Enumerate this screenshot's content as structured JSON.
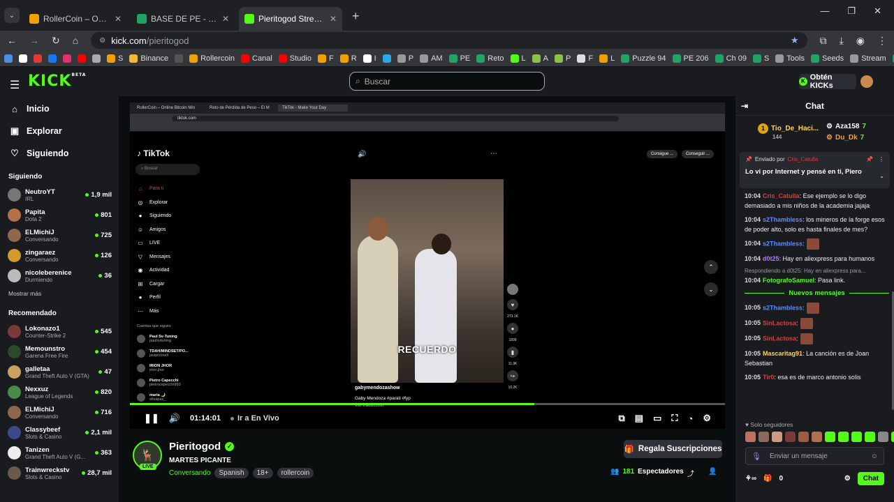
{
  "browser": {
    "tabs": [
      {
        "title": "RollerCoin – Online Bitcoin Mi",
        "color": "#f2a100",
        "active": false
      },
      {
        "title": "BASE DE PE - Hojas de cálculo",
        "color": "#1fa463",
        "active": false
      },
      {
        "title": "Pieritogod Stream - Watch",
        "color": "#53fc18",
        "active": true
      }
    ],
    "url_host": "kick.com",
    "url_path": "/pieritogod",
    "bookmarks": [
      {
        "label": "",
        "color": "#4a90e2"
      },
      {
        "label": "",
        "color": "#fff"
      },
      {
        "label": "",
        "color": "#e53935"
      },
      {
        "label": "",
        "color": "#1877f2"
      },
      {
        "label": "",
        "color": "#e1306c"
      },
      {
        "label": "",
        "color": "#ff0000"
      },
      {
        "label": "",
        "color": "#aaa"
      },
      {
        "label": "S",
        "color": "#f2a100"
      },
      {
        "label": "Binance",
        "color": "#f3ba2f"
      },
      {
        "label": "",
        "color": "#555"
      },
      {
        "label": "Rollercoin",
        "color": "#f2a100"
      },
      {
        "label": "Canal",
        "color": "#ff0000"
      },
      {
        "label": "Studio",
        "color": "#ff0000"
      },
      {
        "label": "F",
        "color": "#f2a100"
      },
      {
        "label": "R",
        "color": "#f2a100"
      },
      {
        "label": "I",
        "color": "#fff"
      },
      {
        "label": "",
        "color": "#29a9eb"
      },
      {
        "label": "P",
        "color": "#999"
      },
      {
        "label": "AM",
        "color": "#999"
      },
      {
        "label": "PE",
        "color": "#1fa463"
      },
      {
        "label": "Reto",
        "color": "#1fa463"
      },
      {
        "label": "L",
        "color": "#53fc18"
      },
      {
        "label": "A",
        "color": "#8bc34a"
      },
      {
        "label": "P",
        "color": "#8bc34a"
      },
      {
        "label": "F",
        "color": "#ddd"
      },
      {
        "label": "L",
        "color": "#f2a100"
      },
      {
        "label": "Puzzle 94",
        "color": "#1fa463"
      },
      {
        "label": "PE 206",
        "color": "#1fa463"
      },
      {
        "label": "Ch 09",
        "color": "#1fa463"
      },
      {
        "label": "S",
        "color": "#1fa463"
      },
      {
        "label": "Tools",
        "color": "#999"
      },
      {
        "label": "Seeds",
        "color": "#1fa463"
      },
      {
        "label": "Stream",
        "color": "#999"
      },
      {
        "label": "Sch",
        "color": "#1fa463"
      }
    ]
  },
  "header": {
    "logo": "KICK",
    "logo_beta": "BETA",
    "search_placeholder": "Buscar",
    "get_kicks": "Obtén KICKs"
  },
  "sidebar": {
    "nav": [
      {
        "label": "Inicio",
        "icon": "home-icon",
        "glyph": "⌂"
      },
      {
        "label": "Explorar",
        "icon": "browse-icon",
        "glyph": "▣"
      },
      {
        "label": "Siguiendo",
        "icon": "heart-icon",
        "glyph": "♡"
      }
    ],
    "following_title": "Siguiendo",
    "following": [
      {
        "name": "NeutroYT",
        "category": "IRL",
        "viewers": "1,9 mil",
        "color": "#777"
      },
      {
        "name": "Papita",
        "category": "Dota 2",
        "viewers": "801",
        "color": "#b5704a"
      },
      {
        "name": "ELMichiJ",
        "category": "Conversando",
        "viewers": "725",
        "color": "#8a6a4a"
      },
      {
        "name": "zingaraez",
        "category": "Conversando",
        "viewers": "126",
        "color": "#d29a2a"
      },
      {
        "name": "nicoleberenice",
        "category": "Durmiendo",
        "viewers": "36",
        "color": "#bbb"
      }
    ],
    "show_more": "Mostrar más",
    "recommended_title": "Recomendado",
    "recommended": [
      {
        "name": "Lokonazo1",
        "category": "Counter-Strike 2",
        "viewers": "545",
        "color": "#7a3a3a"
      },
      {
        "name": "Memounstro",
        "category": "Garena Free Fire",
        "viewers": "454",
        "color": "#2a4a2a"
      },
      {
        "name": "galletaa",
        "category": "Grand Theft Auto V (GTA)",
        "viewers": "47",
        "color": "#caa060"
      },
      {
        "name": "Nexxuz",
        "category": "League of Legends",
        "viewers": "820",
        "color": "#4a8a4a"
      },
      {
        "name": "ELMichiJ",
        "category": "Conversando",
        "viewers": "716",
        "color": "#8a6a4a"
      },
      {
        "name": "Classybeef",
        "category": "Slots & Casino",
        "viewers": "2,1 mil",
        "color": "#3a4a8a"
      },
      {
        "name": "Tanizen",
        "category": "Grand Theft Auto V (G...",
        "viewers": "363",
        "color": "#eee"
      },
      {
        "name": "Trainwreckstv",
        "category": "Slots & Casino",
        "viewers": "28,7 mil",
        "color": "#6a5a4a"
      }
    ]
  },
  "player": {
    "inner_tabs": [
      "RollerCoin – Online Bitcoin Min",
      "Reto de Pérdida de Peso – El M",
      "TikTok - Make Your Day"
    ],
    "inner_url": "tiktok.com",
    "tiktok": {
      "logo": "TikTok",
      "search": "Buscar",
      "menu": [
        {
          "label": "Para ti",
          "glyph": "⌂",
          "red": true
        },
        {
          "label": "Explorar",
          "glyph": "◎",
          "red": false
        },
        {
          "label": "Siguiendo",
          "glyph": "●",
          "red": false
        },
        {
          "label": "Amigos",
          "glyph": "☺",
          "red": false
        },
        {
          "label": "LIVE",
          "glyph": "▭",
          "red": false
        },
        {
          "label": "Mensajes",
          "glyph": "▽",
          "red": false
        },
        {
          "label": "Actividad",
          "glyph": "◉",
          "red": false
        },
        {
          "label": "Cargar",
          "glyph": "⊞",
          "red": false
        },
        {
          "label": "Perfil",
          "glyph": "●",
          "red": false
        },
        {
          "label": "Más",
          "glyph": "⋯",
          "red": false
        }
      ],
      "follows_title": "Cuentas que sigues",
      "follows": [
        {
          "name": "Paul Sv-Tuning",
          "handle": "paulsvtuning"
        },
        {
          "name": "TDAH/MINDSET/PO...",
          "handle": "javipiconell"
        },
        {
          "name": "IRION JHOR",
          "handle": "irion.jhor"
        },
        {
          "name": "Pietro Capecchi",
          "handle": "pietrocapecchi993"
        },
        {
          "name": "maria 🌙",
          "handle": "ellsapaz_"
        }
      ],
      "top_right": [
        "Consigue ...",
        "Conseguir ..."
      ],
      "caption_overlay": "RECUERDO",
      "author": "gabymendozashow",
      "description": "Gaby Mendoza #parati #fyp",
      "translate": "Ver traducción",
      "counts": [
        "273.1K",
        "1899",
        "11.9K",
        "10.2K"
      ]
    },
    "progress": 0.68,
    "time": "01:14:01",
    "go_live": "Ir a En Vivo"
  },
  "streamer": {
    "name": "Pieritogod",
    "title": "MARTES PICANTE",
    "category": "Conversando",
    "tags": [
      "Spanish",
      "18+",
      "rollercoin"
    ],
    "live_label": "LIVE",
    "gift_button": "Regala Suscripciones",
    "viewers_count": "181",
    "viewers_label": "Espectadores"
  },
  "chat": {
    "title": "Chat",
    "leaderboard": {
      "first_name": "Tio_De_Haci...",
      "first_rank": "1",
      "first_score": "144",
      "second_name": "Aza158",
      "second_score": "7",
      "third_name": "Du_Dk",
      "third_score": "7"
    },
    "pinned": {
      "sent_by": "Enviado por",
      "user": "Cris_Catulla",
      "message": "Lo vi por Internet y pensé en ti, Piero"
    },
    "messages": [
      {
        "time": "10:04",
        "user": "Cris_Catulla",
        "color": "#e23b3b",
        "text": ": Ese ejemplo se lo digo demasiado a mis niños de la academia jajaja"
      },
      {
        "time": "10:04",
        "user": "s2Thambless",
        "color": "#5b8dff",
        "text": ": los mineros de la forge esos de poder alto, solo es hasta finales de mes?"
      },
      {
        "time": "10:04",
        "user": "s2Thambless",
        "color": "#5b8dff",
        "text": ":"
      },
      {
        "time": "10:04",
        "user": "d0t25",
        "color": "#b67df8",
        "text": ": Hay en aliexpress para humanos"
      },
      {
        "time": "10:04",
        "user": "FotografoSamuel",
        "color": "#53fc18",
        "text": ": Pasa link.",
        "reply": "Respondiendo a d0t25: Hay en aliexpress para..."
      }
    ],
    "new_messages": "Nuevos mensajes",
    "messages2": [
      {
        "time": "10:05",
        "user": "s2Thambless",
        "color": "#5b8dff",
        "text": ":"
      },
      {
        "time": "10:05",
        "user": "SinLactosa",
        "color": "#e23b3b",
        "text": ":"
      },
      {
        "time": "10:05",
        "user": "SinLactosa",
        "color": "#e23b3b",
        "text": ":"
      },
      {
        "time": "10:05",
        "user": "Mascaritag91",
        "color": "#ffd54f",
        "text": ": La canción es de Joan Sebastian"
      },
      {
        "time": "10:05",
        "user": "Tir0",
        "color": "#e23b3b",
        "text": ": esa es de marco antonio solis"
      }
    ],
    "followers_only": "Solo seguidores",
    "input_placeholder": "Enviar un mensaje",
    "footer_count": "0",
    "send_label": "Chat"
  }
}
